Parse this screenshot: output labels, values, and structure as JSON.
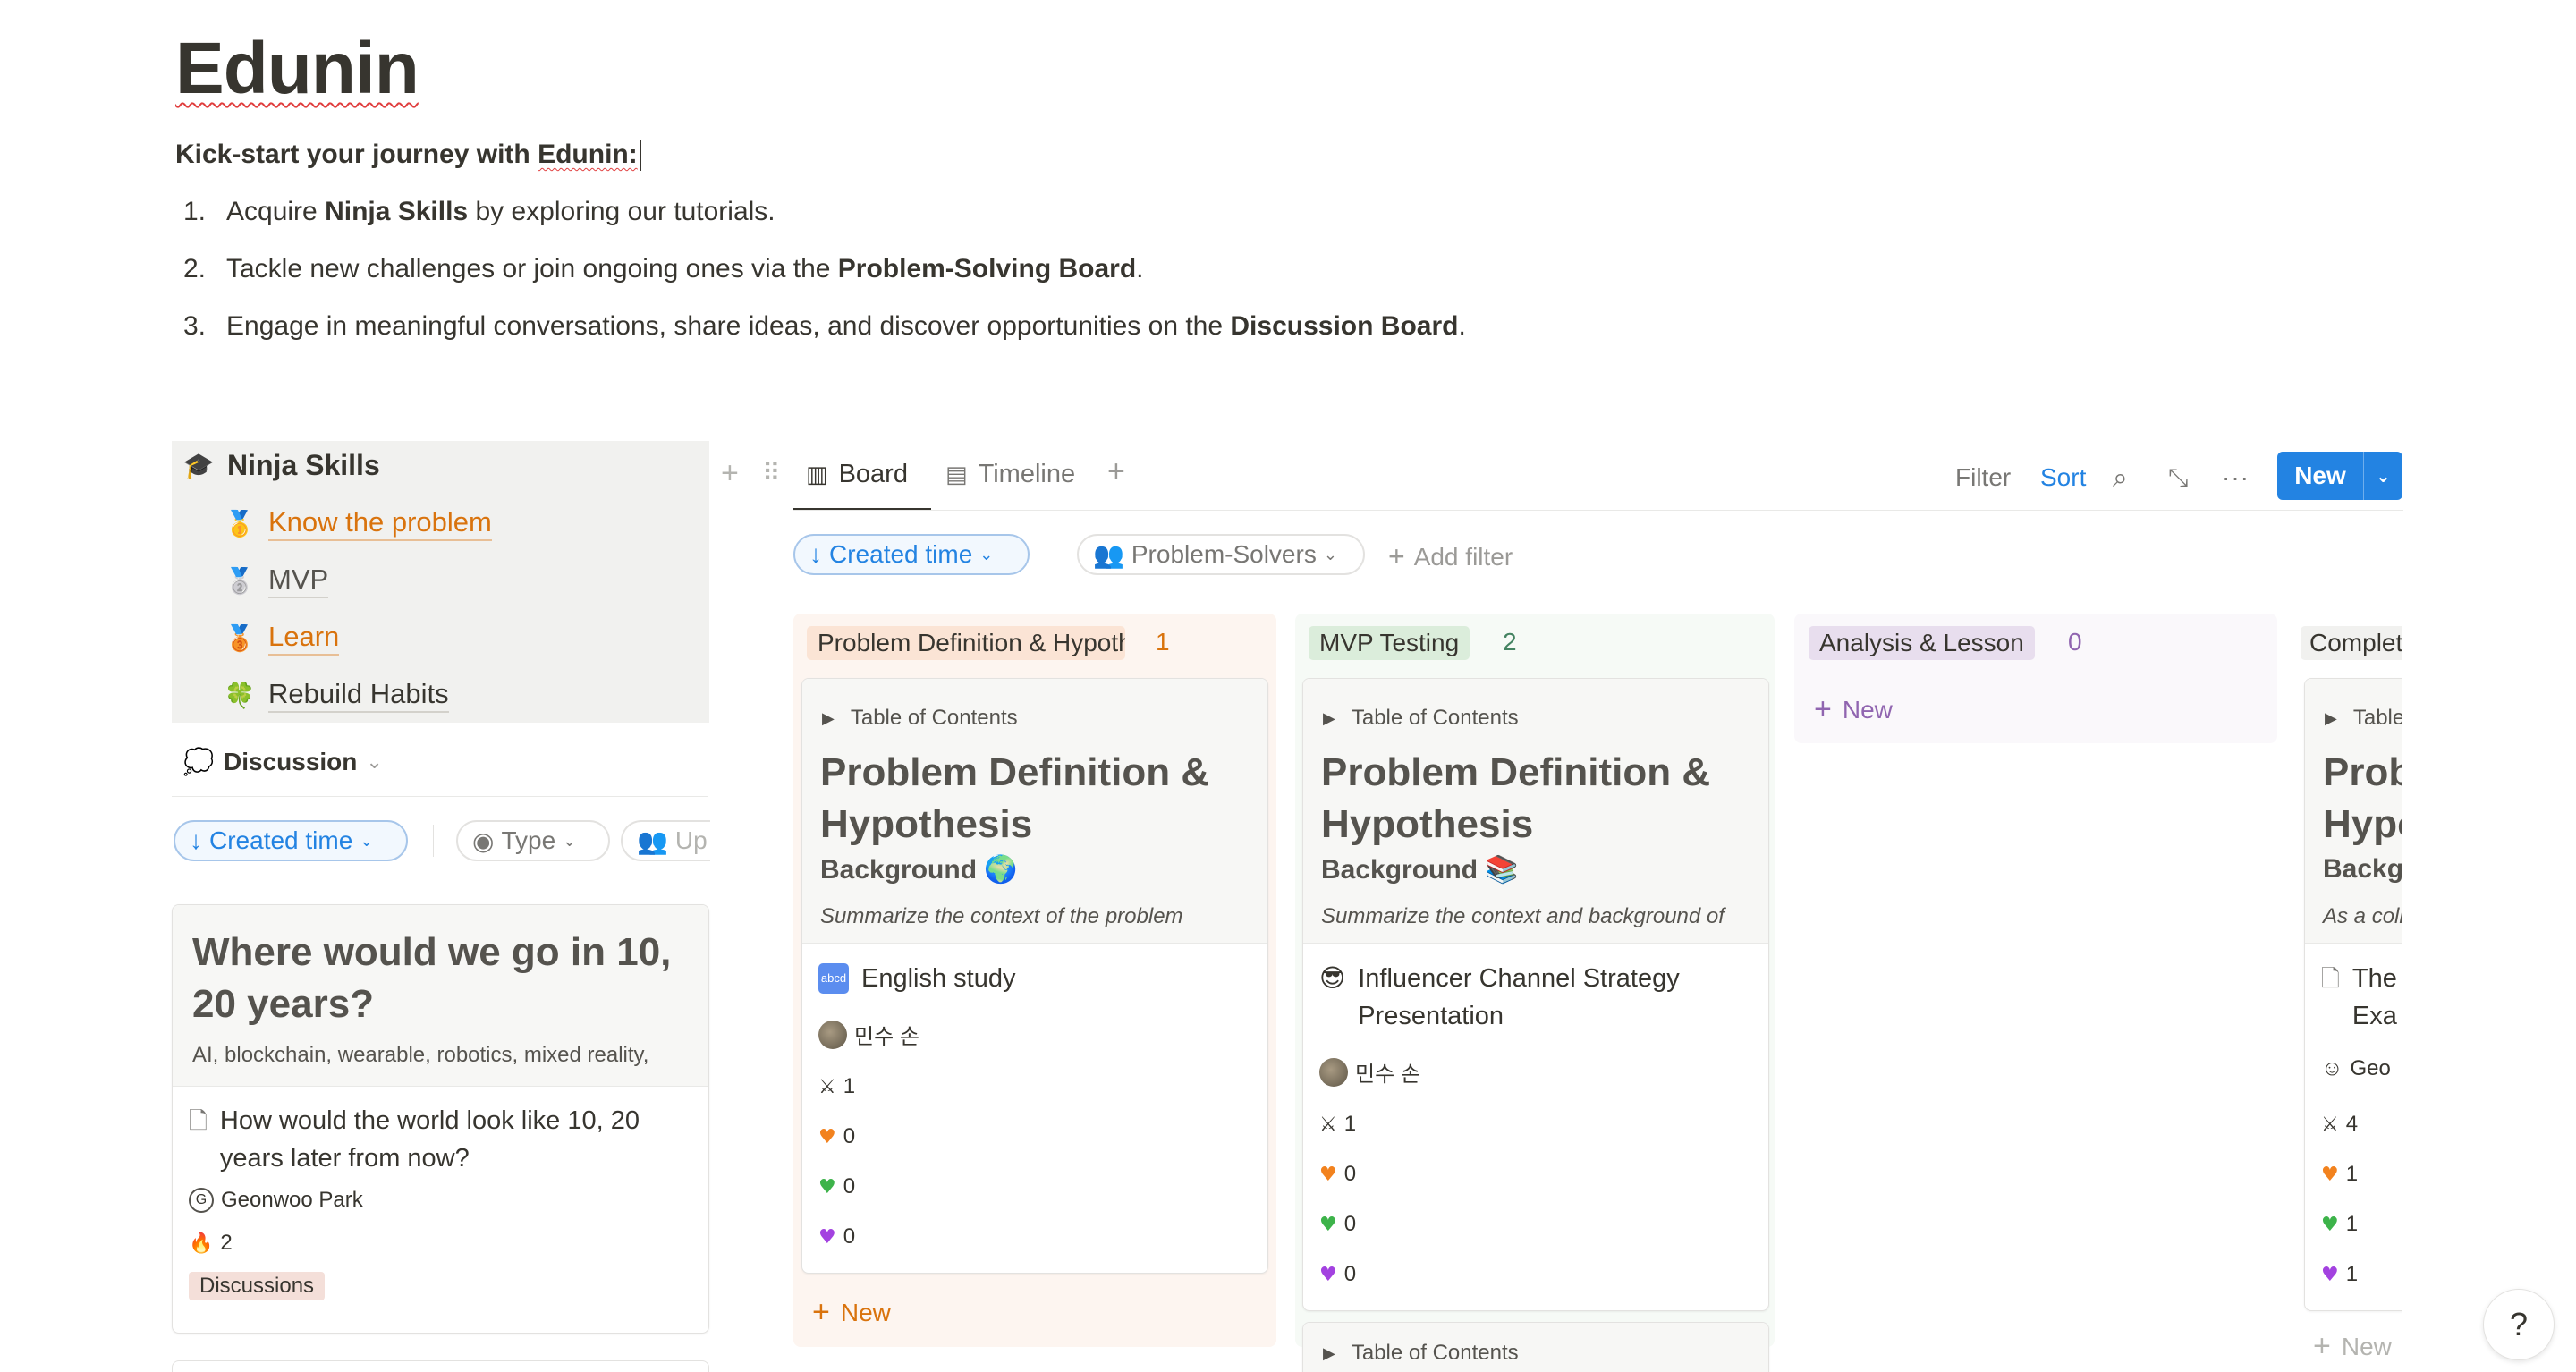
{
  "page": {
    "title": "Edunin",
    "intro_prefix": "Kick-start your journey with ",
    "intro_brand": "Edunin:",
    "steps": [
      {
        "num": "1.",
        "pre": "Acquire ",
        "bold": "Ninja Skills",
        "post": " by exploring our tutorials."
      },
      {
        "num": "2.",
        "pre": "Tackle new challenges or join ongoing ones via the ",
        "bold": "Problem-Solving Board",
        "post": "."
      },
      {
        "num": "3.",
        "pre": "Engage in meaningful conversations, share ideas, and discover opportunities on the ",
        "bold": "Discussion Board",
        "post": "."
      }
    ]
  },
  "ninja": {
    "title": "Ninja Skills",
    "title_icon": "graduation-cap-icon",
    "items": [
      {
        "label": "Know the problem",
        "icon": "gold-medal-icon",
        "glyph": "🥇"
      },
      {
        "label": "MVP",
        "icon": "silver-medal-icon",
        "glyph": "🥈"
      },
      {
        "label": "Learn",
        "icon": "bronze-medal-icon",
        "glyph": "🥉"
      },
      {
        "label": "Rebuild Habits",
        "icon": "four-leaf-clover-icon",
        "glyph": "🍀"
      }
    ]
  },
  "discussion": {
    "title": "Discussion",
    "filters": {
      "created": "Created time",
      "type": "Type",
      "up": "Up"
    },
    "card": {
      "preview_title": "Where would we go in 10, 20 years?",
      "preview_text": "AI, blockchain, wearable, robotics, mixed reality,",
      "title": "How would the world look like 10, 20 years later from now?",
      "author": "Geonwoo Park",
      "fire_count": "2",
      "tag": "Discussions"
    }
  },
  "board": {
    "tabs": {
      "board": "Board",
      "timeline": "Timeline"
    },
    "toolbar": {
      "filter": "Filter",
      "sort": "Sort",
      "new": "New"
    },
    "filters": {
      "created": "Created time",
      "solvers": "Problem-Solvers",
      "add": "Add filter"
    },
    "columns": [
      {
        "name": "Problem Definition & Hypothesis",
        "count": "1",
        "color": "#fbe4d5",
        "text_color": "#d9730d",
        "card": {
          "toc": "Table of Contents",
          "h1_a": "Problem Definition &",
          "h1_b": "Hypothesis",
          "h3": "Background 🌍",
          "summary": "Summarize the context of the problem",
          "title": "English study",
          "author": "민수 손",
          "swords": "1",
          "orange": "0",
          "green": "0",
          "purple": "0"
        },
        "new_label": "New"
      },
      {
        "name": "MVP Testing",
        "count": "2",
        "color": "#dbeddb",
        "text_color": "#448361",
        "card": {
          "toc": "Table of Contents",
          "h1_a": "Problem Definition &",
          "h1_b": "Hypothesis",
          "h3": "Background 📚",
          "summary": "Summarize the context and background of",
          "title_a": "Influencer Channel Strategy",
          "title_b": "Presentation",
          "author": "민수 손",
          "swords": "1",
          "orange": "0",
          "green": "0",
          "purple": "0"
        },
        "second_toc": "Table of Contents"
      },
      {
        "name": "Analysis & Lesson",
        "count": "0",
        "color": "#e8deee",
        "text_color": "#9065b0",
        "new_label": "New"
      },
      {
        "name": "Completed",
        "card": {
          "toc": "Table of Contents",
          "h1_a": "Problem Definition &",
          "h1_b": "Hypothesis",
          "h3": "Background",
          "summary": "As a collaborative",
          "title_a": "The",
          "title_b": "Exa",
          "author": "Geo",
          "swords": "4",
          "orange": "1",
          "green": "1",
          "purple": "1"
        },
        "new_label": "New"
      }
    ]
  },
  "help": "?"
}
